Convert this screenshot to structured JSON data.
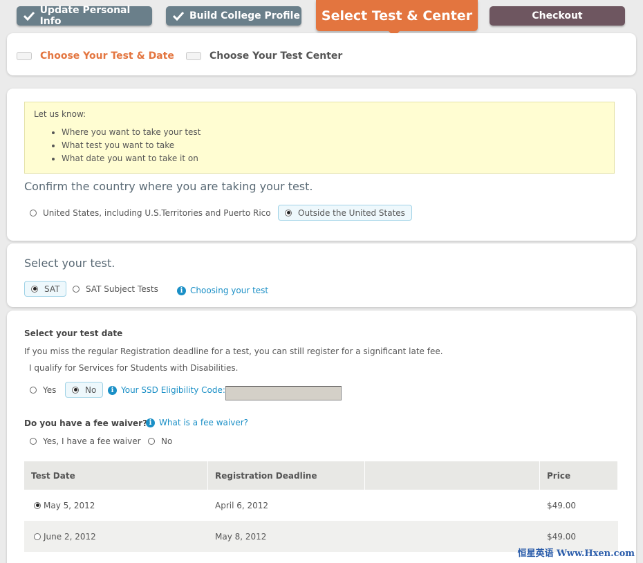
{
  "steps": {
    "update_info": "Update Personal Info",
    "college_profile": "Build College Profile",
    "select_test": "Select Test & Center",
    "checkout": "Checkout"
  },
  "substeps": {
    "choose_test": "Choose Your Test & Date",
    "choose_center": "Choose Your Test Center"
  },
  "note": {
    "intro": "Let us know:",
    "items": [
      "Where you want to take your test",
      "What test you want to take",
      "What date you want to take it on"
    ]
  },
  "country": {
    "heading": "Confirm the country where you are taking your test.",
    "option_us": "United States, including U.S.Territories and Puerto Rico",
    "option_outside": "Outside the United States",
    "selected": "outside"
  },
  "test": {
    "heading": "Select your test.",
    "option_sat": "SAT",
    "option_subject": "SAT Subject Tests",
    "help_link": "Choosing your test",
    "selected": "sat"
  },
  "date": {
    "heading": "Select your test date",
    "late_fee_note": "If you miss the regular Registration deadline for a test, you can still register for a significant late fee.",
    "ssd_question": "I qualify for Services for Students with Disabilities.",
    "ssd_yes": "Yes",
    "ssd_no": "No",
    "ssd_code_label": "Your SSD Eligibility Code:",
    "ssd_code_value": "",
    "fee_waiver_question": "Do you have a fee waiver?",
    "fee_waiver_link": "What is a fee waiver?",
    "fee_waiver_yes": "Yes, I have a fee waiver",
    "fee_waiver_no": "No"
  },
  "table": {
    "headers": [
      "Test Date",
      "Registration Deadline",
      "",
      "Price"
    ],
    "rows": [
      {
        "date": "May 5, 2012",
        "deadline": "April 6, 2012",
        "extra": "",
        "price": "$49.00",
        "selected": true
      },
      {
        "date": "June 2, 2012",
        "deadline": "May 8, 2012",
        "extra": "",
        "price": "$49.00",
        "selected": false
      }
    ]
  },
  "watermark": "恒星英语 Www.Hxen.com",
  "colors": {
    "accent": "#e3753f",
    "step_done": "#6a7f8a",
    "checkout": "#6e5660",
    "link": "#1a8fc6",
    "note_bg": "#fffdd2"
  }
}
